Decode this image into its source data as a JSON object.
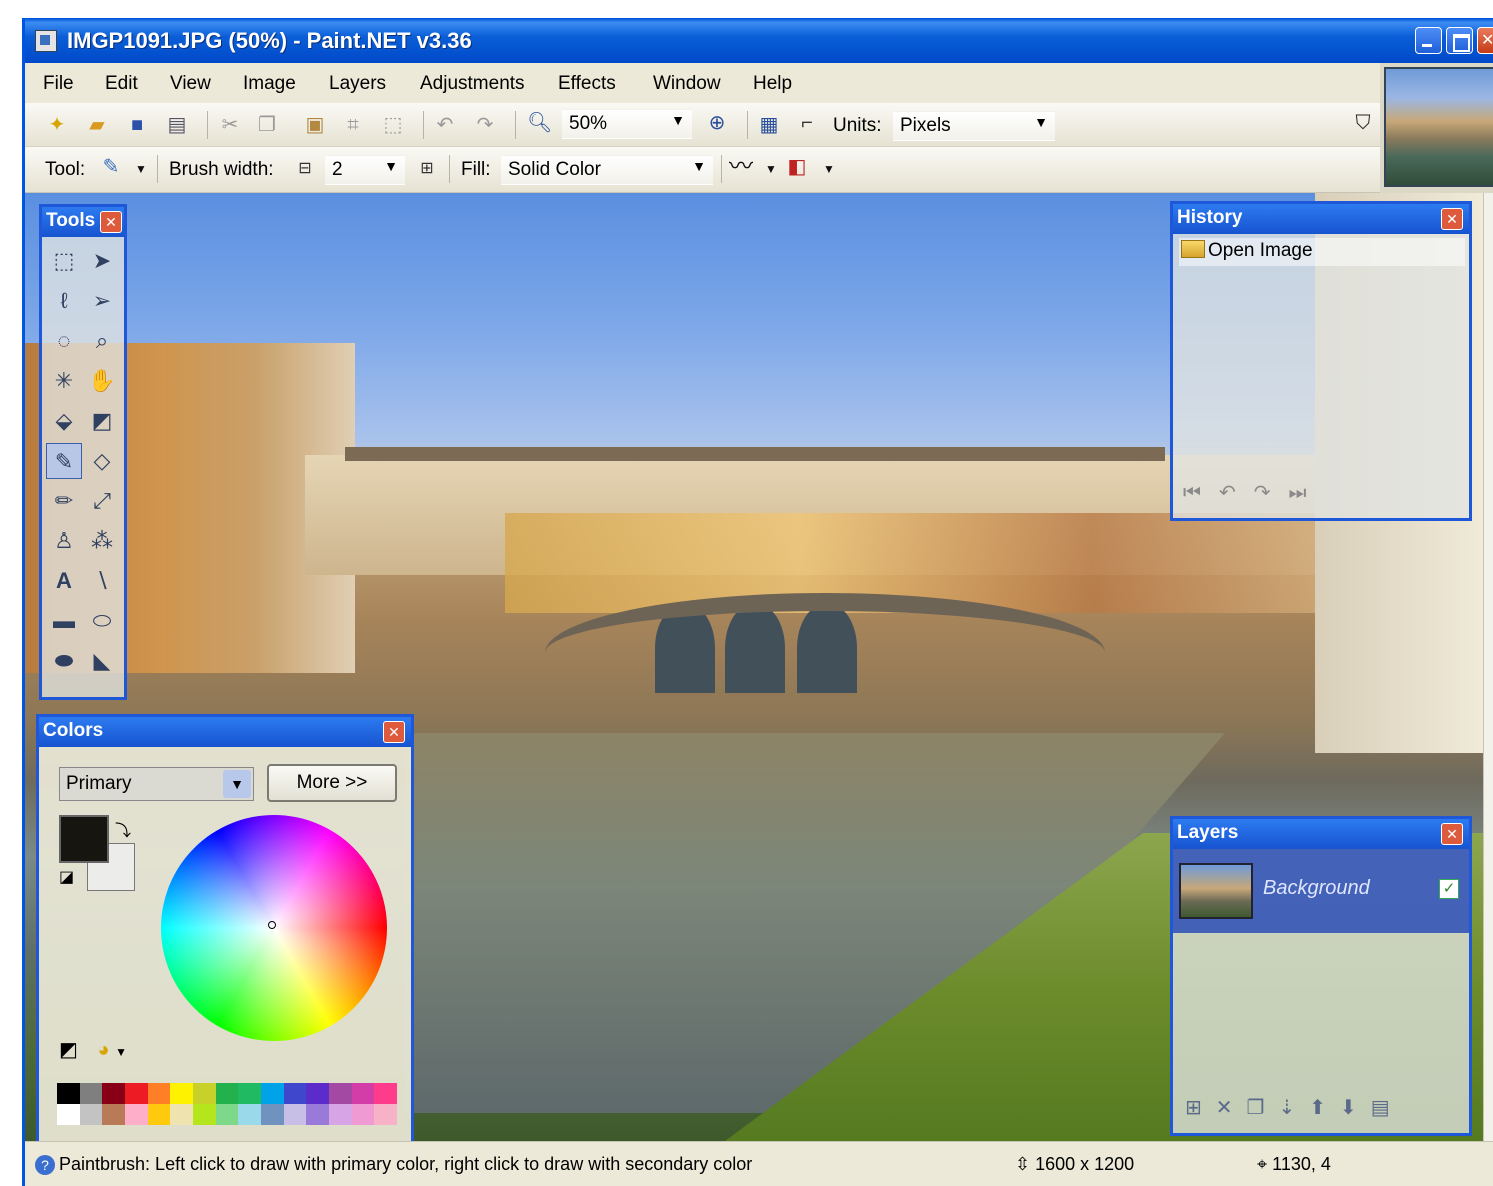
{
  "window": {
    "title": "IMGP1091.JPG (50%) - Paint.NET v3.36"
  },
  "menu": [
    "File",
    "Edit",
    "View",
    "Image",
    "Layers",
    "Adjustments",
    "Effects",
    "Window",
    "Help"
  ],
  "toolbar": {
    "zoom_value": "50%",
    "units_label": "Units:",
    "units_value": "Pixels"
  },
  "tool_options": {
    "tool_label": "Tool:",
    "brush_width_label": "Brush width:",
    "brush_width_value": "2",
    "fill_label": "Fill:",
    "fill_value": "Solid Color"
  },
  "panels": {
    "tools_title": "Tools",
    "colors_title": "Colors",
    "history_title": "History",
    "layers_title": "Layers"
  },
  "colors": {
    "mode_value": "Primary",
    "more_button": "More >>",
    "primary_color": "#17150f",
    "secondary_color": "#ececea"
  },
  "history": {
    "items": [
      "Open Image"
    ]
  },
  "layers": {
    "items": [
      {
        "name": "Background",
        "visible": true
      }
    ]
  },
  "status": {
    "hint": "Paintbrush: Left click to draw with primary color, right click to draw with secondary color",
    "image_size": "1600 x 1200",
    "cursor_position": "1130, 4"
  },
  "palette": {
    "top": [
      "#000000",
      "#7f7f7f",
      "#880015",
      "#ed1c24",
      "#ff7f27",
      "#fff200",
      "#c8d12a",
      "#22b14c",
      "#1fba62",
      "#00a2e8",
      "#3f48cc",
      "#5b2cc9",
      "#a349a4",
      "#d33da8",
      "#ff3c8c"
    ],
    "bottom": [
      "#ffffff",
      "#c3c3c3",
      "#b97a57",
      "#ffaec9",
      "#ffc90e",
      "#efe4b0",
      "#b5e61d",
      "#7ed889",
      "#99d9ea",
      "#7092be",
      "#c8bfe7",
      "#9a7ad8",
      "#d7a4e5",
      "#ef9ad2",
      "#f7b2c8"
    ]
  }
}
